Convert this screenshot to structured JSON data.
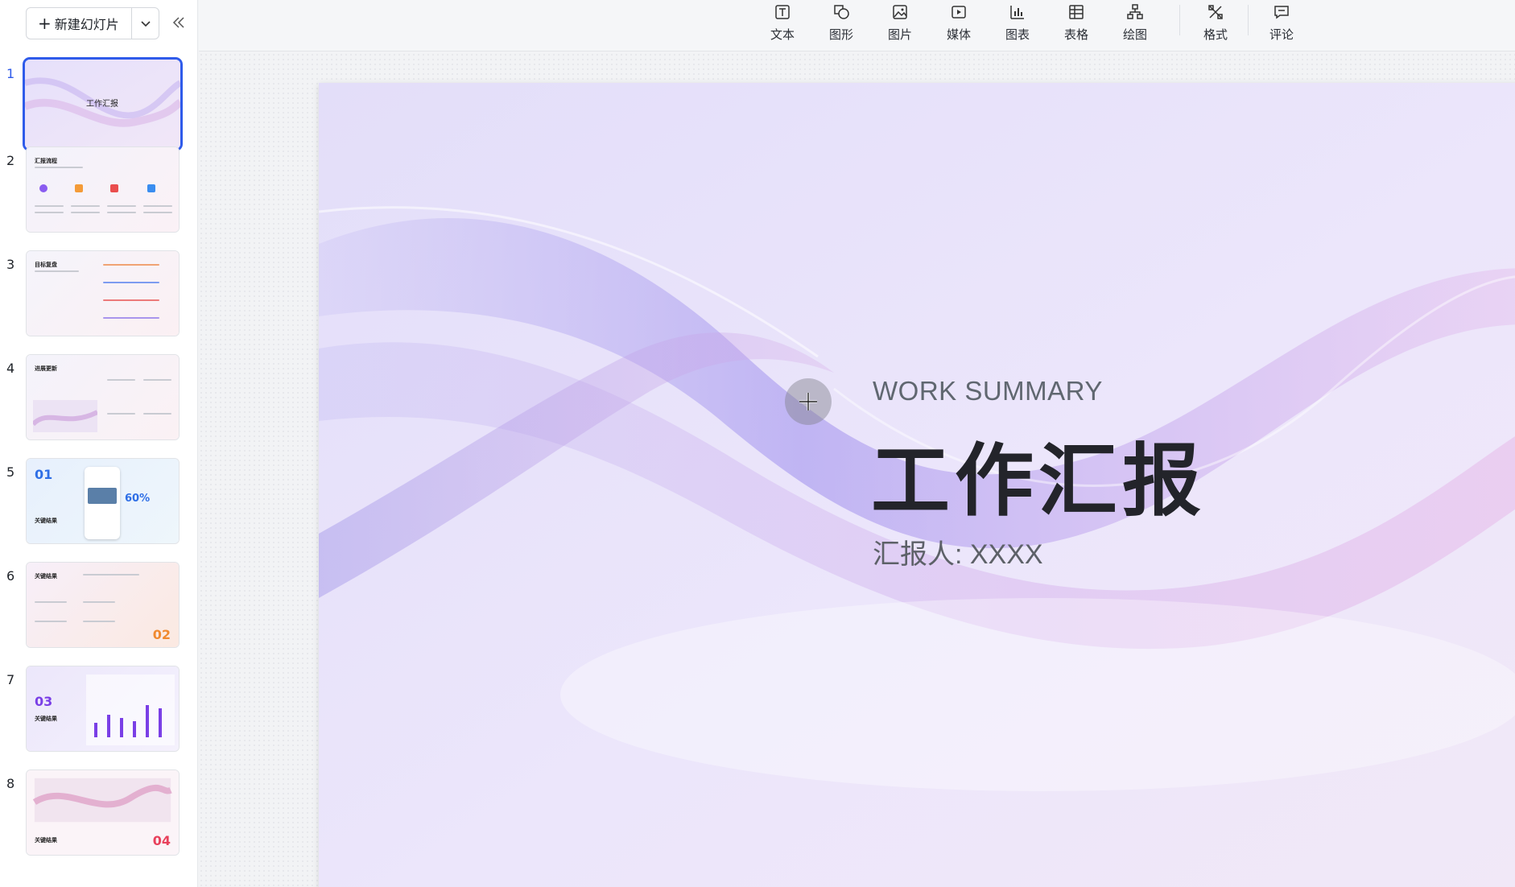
{
  "sidebar": {
    "new_slide_label": "新建幻灯片",
    "slides": [
      {
        "num": "1",
        "title": "工作汇报"
      },
      {
        "num": "2",
        "title": "汇报流程"
      },
      {
        "num": "3",
        "title": "目标复盘"
      },
      {
        "num": "4",
        "title": "进展更新"
      },
      {
        "num": "5",
        "title": "关键结果",
        "badge": "01",
        "metric": "60%"
      },
      {
        "num": "6",
        "title": "关键结果",
        "badge": "02"
      },
      {
        "num": "7",
        "title": "关键结果",
        "badge": "03"
      },
      {
        "num": "8",
        "title": "关键结果",
        "badge": "04"
      }
    ]
  },
  "toolbar": {
    "items": [
      {
        "label": "文本",
        "icon": "text-icon"
      },
      {
        "label": "图形",
        "icon": "shape-icon"
      },
      {
        "label": "图片",
        "icon": "image-icon"
      },
      {
        "label": "媒体",
        "icon": "media-icon"
      },
      {
        "label": "图表",
        "icon": "chart-icon"
      },
      {
        "label": "表格",
        "icon": "table-icon"
      },
      {
        "label": "绘图",
        "icon": "diagram-icon"
      },
      {
        "label": "格式",
        "icon": "format-icon"
      },
      {
        "label": "评论",
        "icon": "comment-icon"
      }
    ]
  },
  "slide": {
    "subtitle": "WORK SUMMARY",
    "title": "工作汇报",
    "reporter": "汇报人: XXXX"
  },
  "colors": {
    "accent": "#2f5bea",
    "slide_bg": "#ece6fb"
  }
}
